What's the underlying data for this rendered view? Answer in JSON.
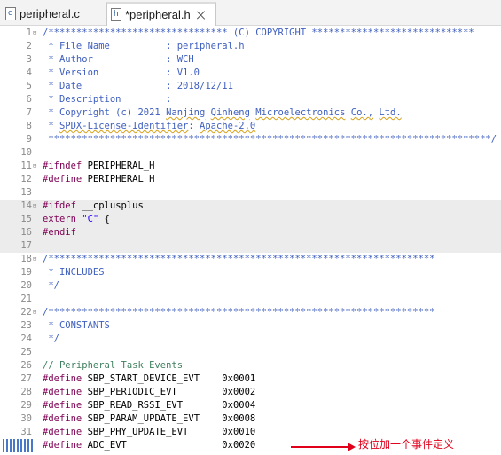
{
  "tabs": [
    {
      "label": "peripheral.c",
      "icon": "c-file-icon",
      "glyph": "c"
    },
    {
      "label": "*peripheral.h",
      "icon": "h-file-icon",
      "glyph": "h",
      "active": true
    }
  ],
  "lines": [
    {
      "n": "1",
      "text": "/******************************** (C) COPYRIGHT *****************************"
    },
    {
      "n": "2",
      "text": " * File Name          : peripheral.h"
    },
    {
      "n": "3",
      "text": " * Author             : WCH"
    },
    {
      "n": "4",
      "text": " * Version            : V1.0"
    },
    {
      "n": "5",
      "text": " * Date               : 2018/12/11"
    },
    {
      "n": "6",
      "text": " * Description        :"
    },
    {
      "n": "7",
      "text": " * Copyright (c) 2021 Nanjing Qinheng Microelectronics Co., Ltd."
    },
    {
      "n": "8",
      "text": " * SPDX-License-Identifier: Apache-2.0"
    },
    {
      "n": "9",
      "text": " *******************************************************************************/"
    },
    {
      "n": "10",
      "text": ""
    },
    {
      "n": "11",
      "text": "#ifndef PERIPHERAL_H"
    },
    {
      "n": "12",
      "text": "#define PERIPHERAL_H"
    },
    {
      "n": "13",
      "text": ""
    },
    {
      "n": "14",
      "text": "#ifdef __cplusplus"
    },
    {
      "n": "15",
      "text": "extern \"C\" {"
    },
    {
      "n": "16",
      "text": "#endif"
    },
    {
      "n": "17",
      "text": ""
    },
    {
      "n": "18",
      "text": "/*********************************************************************"
    },
    {
      "n": "19",
      "text": " * INCLUDES"
    },
    {
      "n": "20",
      "text": " */"
    },
    {
      "n": "21",
      "text": ""
    },
    {
      "n": "22",
      "text": "/*********************************************************************"
    },
    {
      "n": "23",
      "text": " * CONSTANTS"
    },
    {
      "n": "24",
      "text": " */"
    },
    {
      "n": "25",
      "text": ""
    },
    {
      "n": "26",
      "text": "// Peripheral Task Events"
    },
    {
      "n": "27",
      "text": "#define SBP_START_DEVICE_EVT    0x0001"
    },
    {
      "n": "28",
      "text": "#define SBP_PERIODIC_EVT        0x0002"
    },
    {
      "n": "29",
      "text": "#define SBP_READ_RSSI_EVT       0x0004"
    },
    {
      "n": "30",
      "text": "#define SBP_PARAM_UPDATE_EVT    0x0008"
    },
    {
      "n": "31",
      "text": "#define SBP_PHY_UPDATE_EVT      0x0010"
    },
    {
      "n": "32",
      "text": "#define ADC_EVT                 0x0020"
    }
  ],
  "annotation": "按位加一个事件定义"
}
